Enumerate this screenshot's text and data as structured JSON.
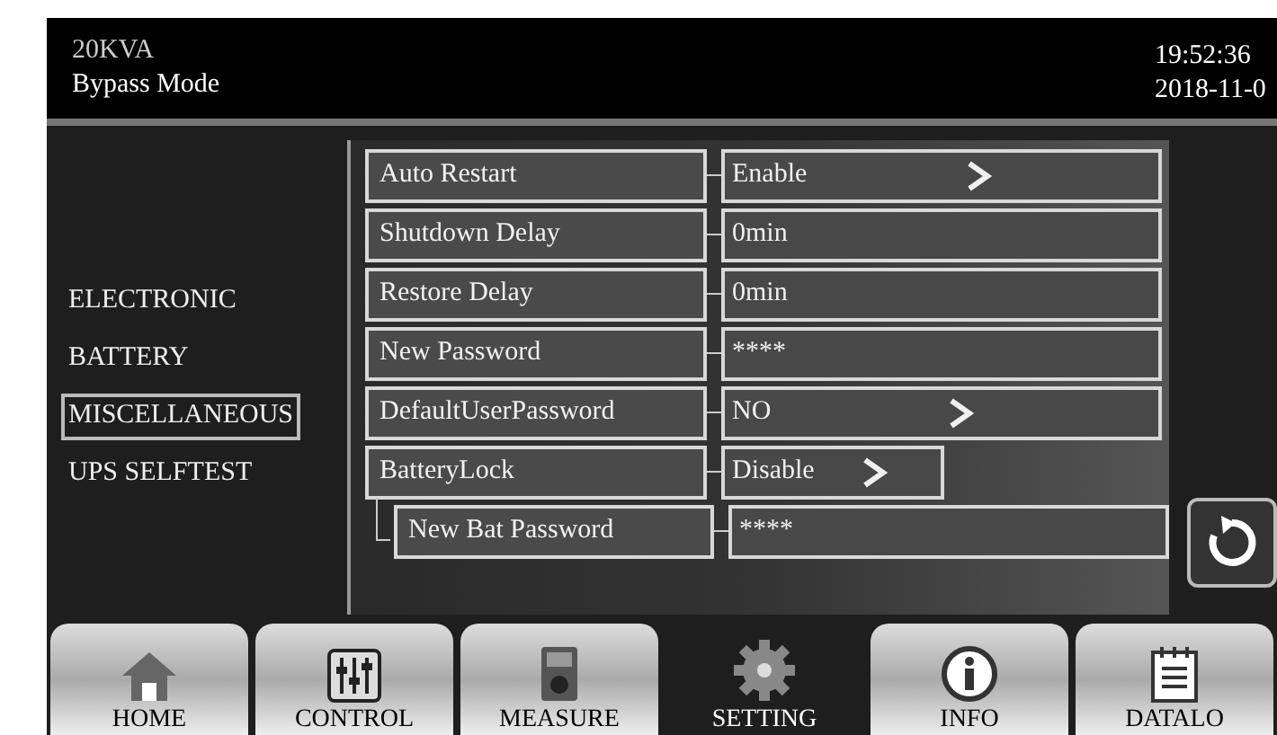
{
  "header": {
    "model": "20KVA",
    "mode": "Bypass Mode",
    "time": "19:52:36",
    "date": "2018-11-0"
  },
  "menu": [
    {
      "label": "ELECTRONIC",
      "selected": false
    },
    {
      "label": "BATTERY",
      "selected": false
    },
    {
      "label": "MISCELLANEOUS",
      "selected": true
    },
    {
      "label": "UPS SELFTEST",
      "selected": false
    }
  ],
  "settings": [
    {
      "label": "Auto Restart",
      "value": "Enable",
      "arrow": true
    },
    {
      "label": "Shutdown Delay",
      "value": "0min",
      "arrow": false
    },
    {
      "label": "Restore Delay",
      "value": "0min",
      "arrow": false
    },
    {
      "label": "New Password",
      "value": "****",
      "arrow": false
    },
    {
      "label": "DefaultUserPassword",
      "value": "NO",
      "arrow": true
    },
    {
      "label": "BatteryLock",
      "value": "Disable",
      "arrow": true,
      "children": [
        {
          "label": "New Bat Password",
          "value": "****",
          "arrow": false
        }
      ]
    }
  ],
  "tabs": [
    {
      "label": "HOME",
      "kind": "home",
      "selected": false
    },
    {
      "label": "CONTROL",
      "kind": "control",
      "selected": false
    },
    {
      "label": "MEASURE",
      "kind": "measure",
      "selected": false
    },
    {
      "label": "SETTING",
      "kind": "setting",
      "selected": true
    },
    {
      "label": "INFO",
      "kind": "info",
      "selected": false
    },
    {
      "label": "DATALO",
      "kind": "datalog",
      "selected": false
    }
  ]
}
